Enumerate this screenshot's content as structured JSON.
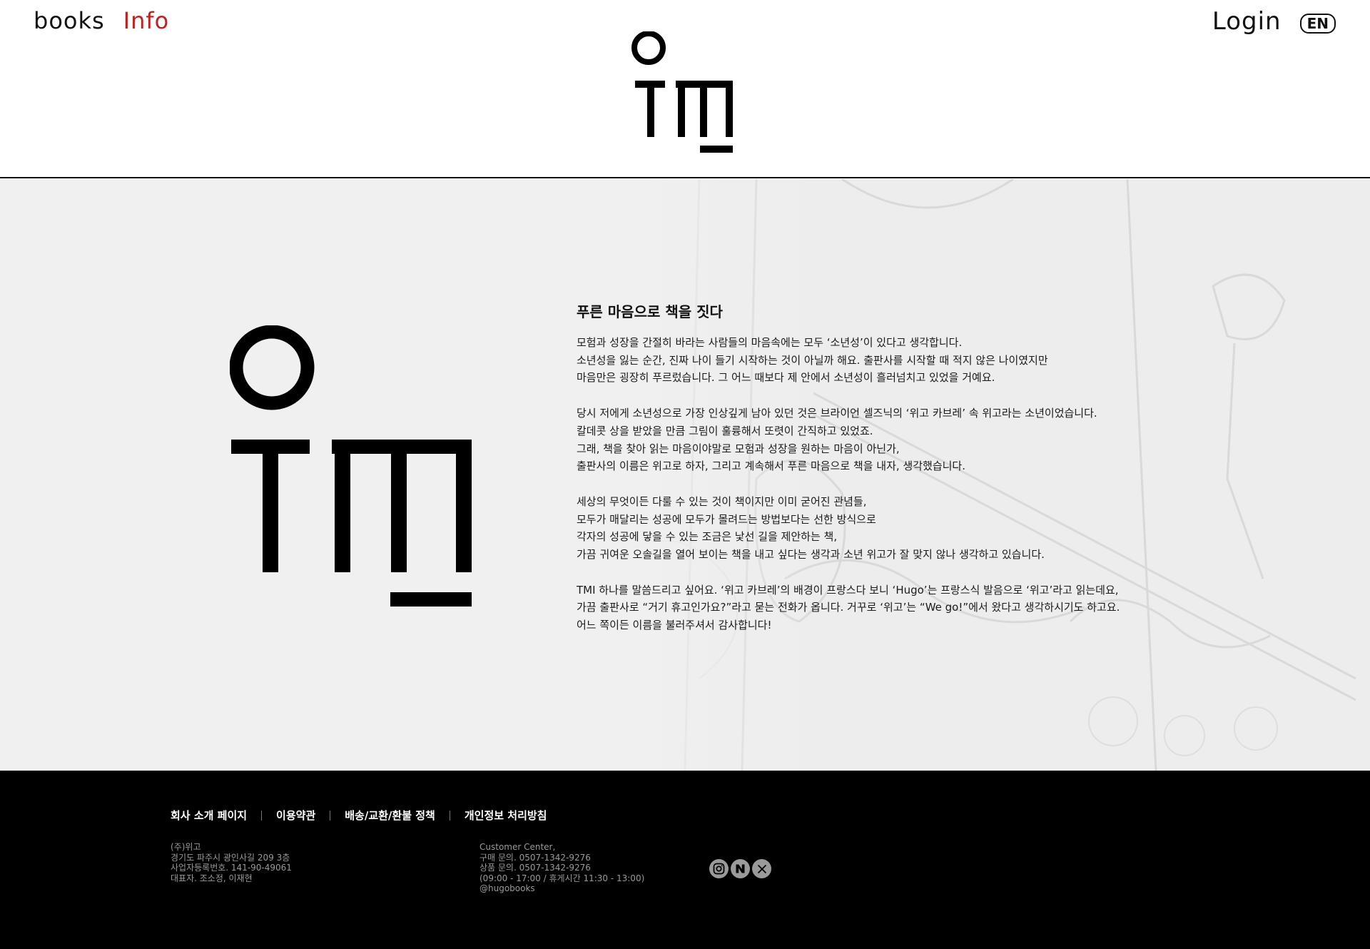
{
  "nav": {
    "left": [
      {
        "label": "books",
        "active": false
      },
      {
        "label": "Info",
        "active": true
      }
    ],
    "login_label": "Login",
    "lang_label": "EN"
  },
  "colors": {
    "accent": "#c0211f",
    "text": "#111111",
    "main_bg": "#f0f0f0",
    "footer_bg": "#000000",
    "footer_text": "#9a9a9a"
  },
  "about": {
    "title": "푸른 마음으로 책을 짓다",
    "paragraphs": [
      [
        "모험과 성장을 간절히 바라는 사람들의 마음속에는 모두 ‘소년성’이 있다고 생각합니다.",
        "소년성을 잃는 순간, 진짜 나이 들기 시작하는 것이 아닐까 해요. 출판사를 시작할 때 적지 않은 나이였지만",
        "마음만은 굉장히 푸르렀습니다. 그 어느 때보다 제 안에서 소년성이 흘러넘치고 있었을 거예요."
      ],
      [
        "당시 저에게 소년성으로 가장 인상깊게 남아 있던 것은 브라이언 셀즈닉의 ‘위고 카브레’ 속 위고라는 소년이었습니다.",
        "칼데콧 상을 받았을 만큼 그림이 훌륭해서 또렷이 간직하고 있었죠.",
        "그래, 책을 찾아 읽는 마음이야말로 모험과 성장을 원하는 마음이 아닌가,",
        "출판사의 이름은 위고로 하자, 그리고 계속해서 푸른 마음으로 책을 내자, 생각했습니다."
      ],
      [
        "세상의 무엇이든 다룰 수 있는 것이 책이지만 이미 굳어진 관념들,",
        "모두가 매달리는 성공에 모두가 몰려드는 방법보다는 선한 방식으로",
        "각자의 성공에 닿을 수 있는 조금은 낯선 길을 제안하는 책,",
        "가끔 귀여운 오솔길을 열어 보이는 책을 내고 싶다는 생각과 소년 위고가 잘 맞지 않나 생각하고 있습니다."
      ],
      [
        "TMI 하나를 말씀드리고 싶어요. ‘위고 카브레’의 배경이 프랑스다 보니 ‘Hugo’는 프랑스식 발음으로 ‘위고’라고 읽는데요,",
        "가끔 출판사로 “거기 휴고인가요?”라고 묻는 전화가 옵니다. 거꾸로 ‘위고’는 “We go!”에서 왔다고 생각하시기도 하고요.",
        "어느 쪽이든 이름을 불러주셔서 감사합니다!"
      ]
    ]
  },
  "footer": {
    "links": [
      "회사 소개 페이지",
      "이용약관",
      "배송/교환/환불 정책",
      "개인정보 처리방침"
    ],
    "company_lines": [
      "(주)위고",
      "경기도 파주시 광인사길 209 3층",
      "사업자등록번호. 141-90-49061",
      "대표자. 조소정, 이재현"
    ],
    "cs_lines": [
      "Customer Center,",
      "구매 문의. 0507-1342-9276",
      "상품 문의. 0507-1342-9276",
      "(09:00 - 17:00 / 휴게시간 11:30 - 13:00)",
      "@hugobooks"
    ],
    "social_icons": [
      "instagram-icon",
      "naver-icon",
      "x-icon"
    ]
  }
}
